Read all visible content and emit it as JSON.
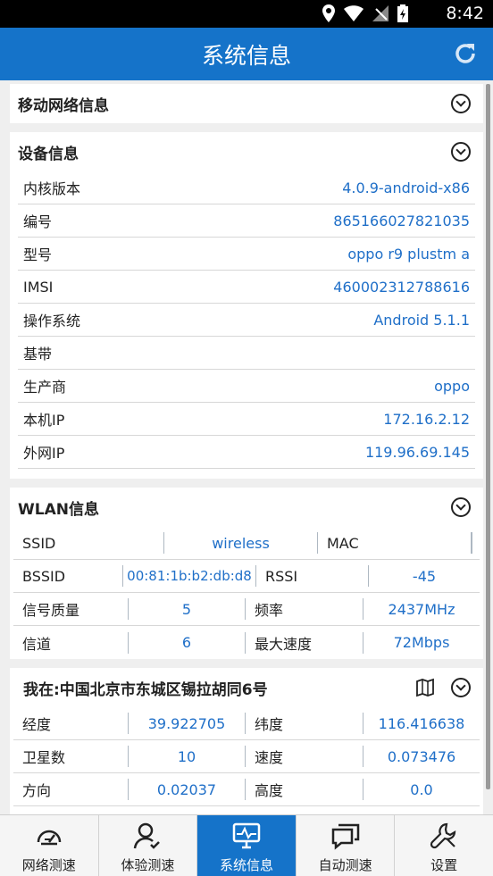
{
  "status_bar": {
    "time": "8:42"
  },
  "app_bar": {
    "title": "系统信息"
  },
  "sections": {
    "mobile": {
      "title": "移动网络信息"
    },
    "device": {
      "title": "设备信息",
      "rows": [
        {
          "label": "内核版本",
          "value": "4.0.9-android-x86"
        },
        {
          "label": "编号",
          "value": "865166027821035"
        },
        {
          "label": "型号",
          "value": "oppo r9 plustm a"
        },
        {
          "label": "IMSI",
          "value": "460002312788616"
        },
        {
          "label": "操作系统",
          "value": "Android 5.1.1"
        },
        {
          "label": "基带",
          "value": ""
        },
        {
          "label": "生产商",
          "value": "oppo"
        },
        {
          "label": "本机IP",
          "value": "172.16.2.12"
        },
        {
          "label": "外网IP",
          "value": "119.96.69.145"
        }
      ]
    },
    "wlan": {
      "title": "WLAN信息",
      "ssid_label": "SSID",
      "ssid_value": "wireless",
      "mac_label": "MAC",
      "mac_value": "",
      "bssid_label": "BSSID",
      "bssid_value": "00:81:1b:b2:db:d8",
      "rssi_label": "RSSI",
      "rssi_value": "-45",
      "quality_label": "信号质量",
      "quality_value": "5",
      "freq_label": "频率",
      "freq_value": "2437MHz",
      "channel_label": "信道",
      "channel_value": "6",
      "speed_label": "最大速度",
      "speed_value": "72Mbps"
    },
    "location": {
      "title": "我在:中国北京市东城区锡拉胡同6号",
      "lon_label": "经度",
      "lon_value": "39.922705",
      "lat_label": "纬度",
      "lat_value": "116.416638",
      "sat_label": "卫星数",
      "sat_value": "10",
      "vel_label": "速度",
      "vel_value": "0.073476",
      "dir_label": "方向",
      "dir_value": "0.02037",
      "alt_label": "高度",
      "alt_value": "0.0"
    }
  },
  "nav": [
    {
      "label": "网络测速",
      "icon": "speedometer-icon"
    },
    {
      "label": "体验测速",
      "icon": "user-check-icon"
    },
    {
      "label": "系统信息",
      "icon": "monitor-icon"
    },
    {
      "label": "自动测速",
      "icon": "chat-icon"
    },
    {
      "label": "设置",
      "icon": "wrench-icon"
    }
  ],
  "colors": {
    "primary": "#1573c9",
    "value_text": "#1f6fc8"
  }
}
